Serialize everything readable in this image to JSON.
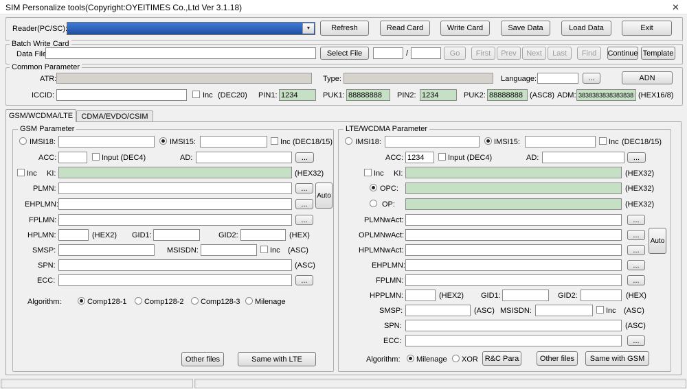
{
  "window": {
    "title": "SIM Personalize tools(Copyright:OYEITIMES Co.,Ltd Ver 3.1.18)",
    "close_icon": "✕"
  },
  "colors": {
    "background": "#f0f0f0",
    "field_green": "#c5e0c5",
    "field_gray": "#d6d3cc",
    "combo_highlight_blue": "#2a62c4",
    "titlebar": "#ffffff"
  },
  "reader_bar": {
    "label": "Reader(PC/SC):",
    "combo_value": "",
    "refresh": "Refresh",
    "read_card": "Read Card",
    "write_card": "Write Card",
    "save_data": "Save Data",
    "load_data": "Load Data",
    "exit": "Exit"
  },
  "batch": {
    "title": "Batch Write Card",
    "data_file_label": "Data File:",
    "data_file_value": "",
    "select_file": "Select File",
    "index_value": "",
    "slash": "/",
    "total_value": "",
    "go": "Go",
    "first": "First",
    "prev": "Prev",
    "next": "Next",
    "last": "Last",
    "find": "Find",
    "continue": "Continue",
    "template": "Template"
  },
  "common": {
    "title": "Common Parameter",
    "atr_label": "ATR:",
    "atr_value": "",
    "type_label": "Type:",
    "type_value": "",
    "language_label": "Language:",
    "language_value": "",
    "adn": "ADN",
    "iccid_label": "ICCID:",
    "iccid_value": "",
    "inc": "Inc",
    "dec20": "(DEC20)",
    "pin1_label": "PIN1:",
    "pin1_value": "1234",
    "puk1_label": "PUK1:",
    "puk1_value": "88888888",
    "pin2_label": "PIN2:",
    "pin2_value": "1234",
    "puk2_label": "PUK2:",
    "puk2_value": "88888888",
    "asc8": "(ASC8)",
    "adm_label": "ADM:",
    "adm_value": "3838383838383838",
    "hex168": "(HEX16/8)"
  },
  "tabs": {
    "gsm": "GSM/WCDMA/LTE",
    "cdma": "CDMA/EVDO/CSIM"
  },
  "shared": {
    "more": "...",
    "inc": "Inc",
    "auto": "Auto",
    "imsi18": "IMSI18:",
    "imsi15": "IMSI15:",
    "dec1815": "(DEC18/15)",
    "acc": "ACC:",
    "input_dec4": "Input (DEC4)",
    "ad": "AD:",
    "ki": "KI:",
    "hex32": "(HEX32)",
    "hex2": "(HEX2)",
    "hex": "(HEX)",
    "asc": "(ASC)",
    "gid1": "GID1:",
    "gid2": "GID2:",
    "smsp": "SMSP:",
    "msisdn": "MSISDN:",
    "spn": "SPN:",
    "ecc": "ECC:",
    "ehplmn": "EHPLMN:",
    "fplmn": "FPLMN:",
    "algorithm": "Algorithm:",
    "other_files": "Other files"
  },
  "gsm": {
    "title": "GSM Parameter",
    "plmn_label": "PLMN:",
    "hplmn_label": "HPLMN:",
    "alg1": "Comp128-1",
    "alg2": "Comp128-2",
    "alg3": "Comp128-3",
    "alg4": "Milenage",
    "same_with_lte": "Same with LTE",
    "imsi18_value": "",
    "imsi15_value": "",
    "acc_value": "",
    "ad_value": "",
    "ki_value": "",
    "plmn_value": "",
    "ehplmn_value": "",
    "fplmn_value": "",
    "hplmn_value": "",
    "gid1_value": "",
    "gid2_value": "",
    "smsp_value": "",
    "msisdn_value": "",
    "spn_value": "",
    "ecc_value": ""
  },
  "lte": {
    "title": "LTE/WCDMA Parameter",
    "opc_label": "OPC:",
    "op_label": "OP:",
    "plmnwact_label": "PLMNwAct:",
    "oplmnwact_label": "OPLMNwAct:",
    "hplmnwact_label": "HPLMNwAct:",
    "hpplmn_label": "HPPLMN:",
    "alg1": "Milenage",
    "alg2": "XOR",
    "rc_para": "R&C Para",
    "same_with_gsm": "Same with GSM",
    "imsi18_value": "",
    "imsi15_value": "",
    "acc_value": "1234",
    "ad_value": "",
    "ki_value": "",
    "opc_value": "",
    "op_value": "",
    "plmnwact_value": "",
    "oplmnwact_value": "",
    "hplmnwact_value": "",
    "ehplmn_value": "",
    "fplmn_value": "",
    "hpplmn_value": "",
    "gid1_value": "",
    "gid2_value": "",
    "smsp_value": "",
    "msisdn_value": "",
    "spn_value": "",
    "ecc_value": ""
  }
}
